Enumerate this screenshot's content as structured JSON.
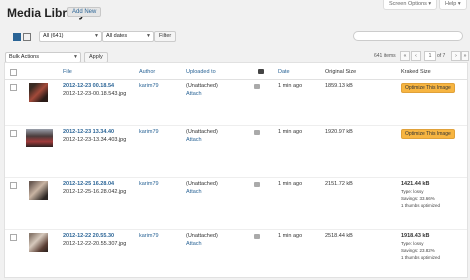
{
  "header": {
    "title": "Media Library",
    "add_new": "Add New",
    "screen_options": "Screen Options ▾",
    "help": "Help ▾"
  },
  "toolbar": {
    "filter_all": "All (641)",
    "filter_dates": "All dates",
    "filter_btn": "Filter",
    "bulk_actions": "Bulk Actions",
    "apply": "Apply",
    "search_placeholder": ""
  },
  "pagination": {
    "items": "641 items",
    "first": "«",
    "prev": "‹",
    "page": "1",
    "of": "of 7",
    "next": "›",
    "last": "»"
  },
  "columns": {
    "file": "File",
    "author": "Author",
    "uploaded_to": "Uploaded to",
    "date": "Date",
    "original_size": "Original Size",
    "kraked_size": "Kraked Size"
  },
  "rows": [
    {
      "title": "2012-12-23 00.18.54",
      "file": "2012-12-23-00.18.543.jpg",
      "author": "karim79",
      "uploaded": "(Unattached)",
      "attach": "Attach",
      "date": "1 min ago",
      "size": "1859.13 kB",
      "kraked": {
        "button": "Optimize This Image"
      }
    },
    {
      "title": "2012-12-23 13.34.40",
      "file": "2012-12-23-13.34.403.jpg",
      "author": "karim79",
      "uploaded": "(Unattached)",
      "attach": "Attach",
      "date": "1 min ago",
      "size": "1920.97 kB",
      "kraked": {
        "button": "Optimize This Image"
      }
    },
    {
      "title": "2012-12-25 16.28.04",
      "file": "2012-12-25-16.28.042.jpg",
      "author": "karim79",
      "uploaded": "(Unattached)",
      "attach": "Attach",
      "date": "1 min ago",
      "size": "2151.72 kB",
      "kraked": {
        "size": "1421.44 kB",
        "type": "Type: lossy",
        "savings": "Savings: 33.66%",
        "thumbs": "1 thumbs optimized"
      }
    },
    {
      "title": "2012-12-22 20.55.30",
      "file": "2012-12-22-20.55.307.jpg",
      "author": "karim79",
      "uploaded": "(Unattached)",
      "attach": "Attach",
      "date": "1 min ago",
      "size": "2518.44 kB",
      "kraked": {
        "size": "1918.43 kB",
        "type": "Type: lossy",
        "savings": "Savings: 23.82%",
        "thumbs": "1 thumbs optimized"
      }
    }
  ],
  "colors": {
    "link": "#2a6496",
    "optimize_button": "#f7b541"
  }
}
